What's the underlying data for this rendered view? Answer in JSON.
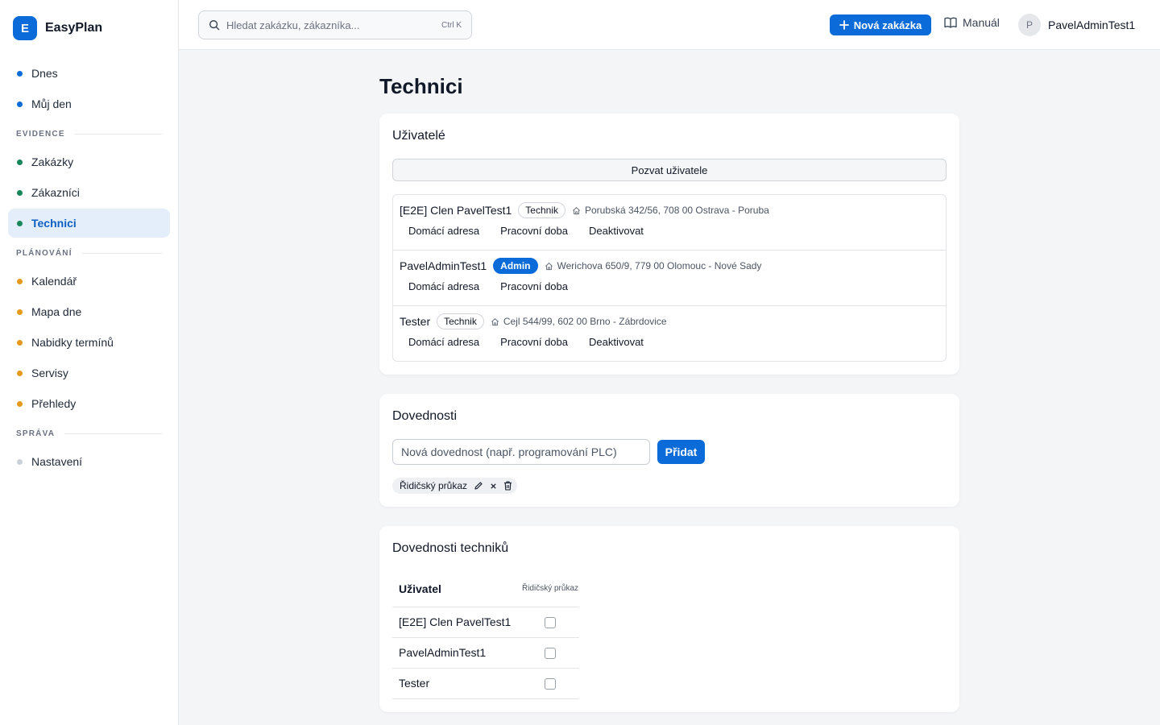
{
  "brand": {
    "logo_letter": "E",
    "name": "EasyPlan"
  },
  "sidebar": {
    "top_items": [
      {
        "label": "Dnes",
        "color": "#0b6bd8"
      },
      {
        "label": "Můj den",
        "color": "#0b6bd8"
      }
    ],
    "sections": [
      {
        "title": "EVIDENCE",
        "items": [
          {
            "label": "Zakázky",
            "color": "#16875b"
          },
          {
            "label": "Zákazníci",
            "color": "#16875b"
          },
          {
            "label": "Technici",
            "color": "#16875b",
            "active": true
          }
        ]
      },
      {
        "title": "PLÁNOVÁNÍ",
        "items": [
          {
            "label": "Kalendář",
            "color": "#e59a1b"
          },
          {
            "label": "Mapa dne",
            "color": "#e59a1b"
          },
          {
            "label": "Nabidky termínů",
            "color": "#e59a1b"
          },
          {
            "label": "Servisy",
            "color": "#e59a1b"
          },
          {
            "label": "Přehledy",
            "color": "#e59a1b"
          }
        ]
      },
      {
        "title": "SPRÁVA",
        "items": [
          {
            "label": "Nastavení",
            "color": "#cbd0d8"
          }
        ]
      }
    ]
  },
  "topbar": {
    "search_placeholder": "Hledat zakázku, zákazníka...",
    "search_shortcut": "Ctrl K",
    "new_order_label": "Nová zakázka",
    "manual_label": "Manuál",
    "user_initial": "P",
    "user_name": "PavelAdminTest1"
  },
  "page": {
    "title": "Technici"
  },
  "users_card": {
    "title": "Uživatelé",
    "invite_label": "Pozvat uživatele",
    "users": [
      {
        "name": "[E2E] Clen PavelTest1",
        "role": "Technik",
        "address": "Porubská 342/56, 708 00 Ostrava - Poruba",
        "actions": [
          "Domácí adresa",
          "Pracovní doba",
          "Deaktivovat"
        ]
      },
      {
        "name": "PavelAdminTest1",
        "role": "Admin",
        "address": "Werichova 650/9, 779 00 Olomouc - Nové Sady",
        "actions": [
          "Domácí adresa",
          "Pracovní doba"
        ]
      },
      {
        "name": "Tester",
        "role": "Technik",
        "address": "Cejl 544/99, 602 00 Brno - Zábrdovice",
        "actions": [
          "Domácí adresa",
          "Pracovní doba",
          "Deaktivovat"
        ]
      }
    ]
  },
  "skills_card": {
    "title": "Dovednosti",
    "input_placeholder": "Nová dovednost (např. programování PLC)",
    "add_label": "Přidat",
    "skills": [
      {
        "label": "Řidičský průkaz"
      }
    ]
  },
  "tech_skills_card": {
    "title": "Dovednosti techniků",
    "col_user": "Uživatel",
    "col_skill": "Řidičský průkaz",
    "rows": [
      {
        "name": "[E2E] Clen PavelTest1",
        "checked": false
      },
      {
        "name": "PavelAdminTest1",
        "checked": false
      },
      {
        "name": "Tester",
        "checked": false
      }
    ]
  }
}
